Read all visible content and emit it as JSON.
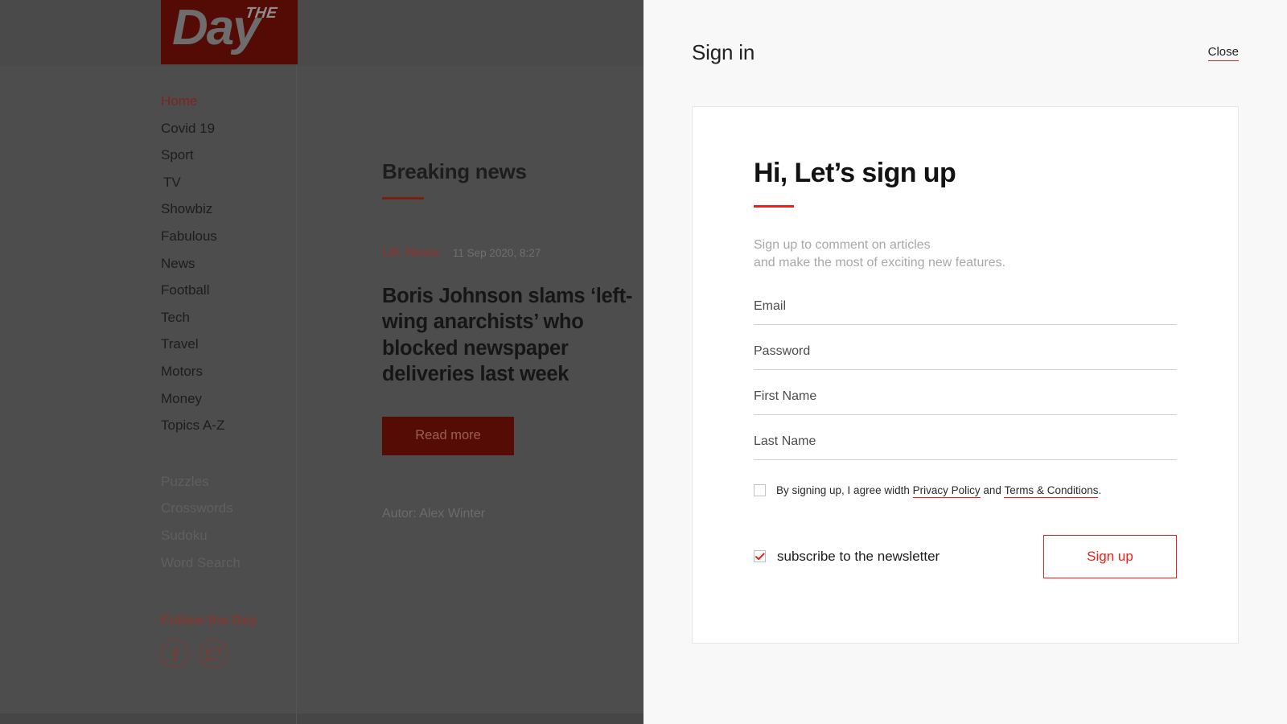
{
  "site": {
    "logo_the": "THE",
    "logo_day": "Day"
  },
  "sidebar": {
    "primary_nav": [
      {
        "label": "Home",
        "active": true
      },
      {
        "label": "Covid 19",
        "active": false
      },
      {
        "label": "Sport",
        "active": false
      },
      {
        "label": "TV",
        "active": false
      },
      {
        "label": "Showbiz",
        "active": false
      },
      {
        "label": "Fabulous",
        "active": false
      },
      {
        "label": "News",
        "active": false
      },
      {
        "label": "Football",
        "active": false
      },
      {
        "label": "Tech",
        "active": false
      },
      {
        "label": "Travel",
        "active": false
      },
      {
        "label": "Motors",
        "active": false
      },
      {
        "label": "Money",
        "active": false
      },
      {
        "label": "Topics A-Z",
        "active": false
      }
    ],
    "secondary_nav": [
      {
        "label": "Puzzles"
      },
      {
        "label": "Crosswords"
      },
      {
        "label": "Sudoku"
      },
      {
        "label": "Word Search"
      }
    ],
    "follow_title": "Follow the Day",
    "social": [
      {
        "name": "facebook-icon"
      },
      {
        "name": "twitter-icon"
      }
    ]
  },
  "article": {
    "section_title": "Breaking news",
    "category": "UK News",
    "date": "11 Sep 2020, 8:27",
    "headline": "Boris Johnson slams ‘left-wing anarchists’ who blocked newspaper deliveries last week",
    "read_more_label": "Read more",
    "author": "Autor: Alex Winter"
  },
  "panel": {
    "title": "Sign in",
    "close_label": "Close",
    "signup_title": "Hi, Let’s sign up",
    "subtitle_line1": "Sign up to comment on articles",
    "subtitle_line2": "and make the most of exciting new features.",
    "fields": [
      {
        "name": "email",
        "placeholder": "Email",
        "value": ""
      },
      {
        "name": "password",
        "placeholder": "Password",
        "value": ""
      },
      {
        "name": "first-name",
        "placeholder": "First Name",
        "value": ""
      },
      {
        "name": "last-name",
        "placeholder": "Last Name",
        "value": ""
      }
    ],
    "terms": {
      "checked": false,
      "text_before": "By signing up, I agree width ",
      "privacy_link": "Privacy Policy",
      "text_middle": " and ",
      "terms_link": "Terms & Conditions",
      "text_after": "."
    },
    "newsletter": {
      "checked": true,
      "label": "subscribe to the newsletter"
    },
    "signup_button_label": "Sign up"
  },
  "colors": {
    "brand_red": "#ee2019",
    "logo_maroon": "#540b06",
    "button_maroon": "#550c05",
    "overlay_dim": "#4d4d4d",
    "panel_bg": "#f8f8f8"
  }
}
